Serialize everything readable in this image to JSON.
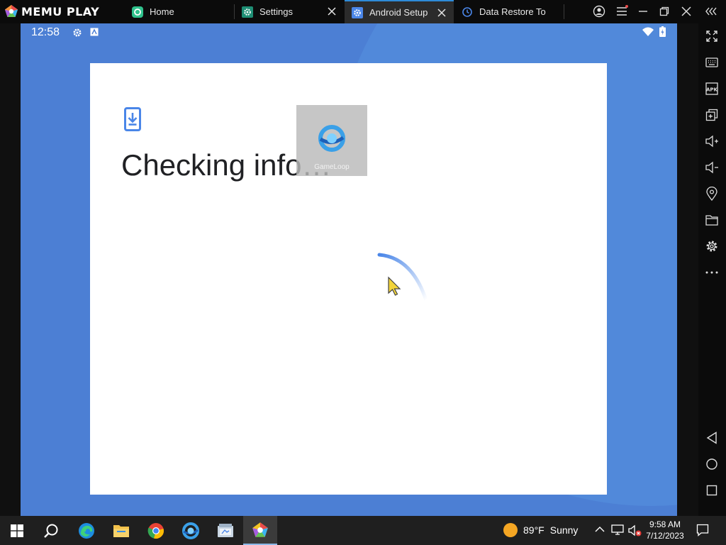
{
  "app": {
    "logo_text": "MEMU PLAY"
  },
  "tabs": [
    {
      "label": "Home",
      "icon": "memu-home-icon"
    },
    {
      "label": "Settings",
      "icon": "settings-app-icon"
    },
    {
      "label": "Android Setup",
      "icon": "android-setup-icon"
    },
    {
      "label": "Data Restore To",
      "icon": "history-icon"
    }
  ],
  "android": {
    "status_time": "12:58",
    "heading": "Checking info…",
    "overlay_label": "GameLoop"
  },
  "colors": {
    "screen_background": "#4c7fd4",
    "accent": "#4a86e8",
    "titlebar": "#0b0b0b",
    "taskbar": "#1f1f1f"
  },
  "sidebar_tools": [
    "fullscreen-icon",
    "keyboard-icon",
    "apk-icon",
    "multi-instance-icon",
    "volume-up-icon",
    "volume-down-icon",
    "location-icon",
    "folder-icon",
    "settings-icon",
    "more-icon",
    "back-icon",
    "home-icon",
    "recents-icon"
  ],
  "sidebar_labels": {
    "apk": "APK"
  },
  "taskbar": {
    "weather_temp": "89°F",
    "weather_desc": "Sunny",
    "time": "9:58 AM",
    "date": "7/12/2023"
  }
}
